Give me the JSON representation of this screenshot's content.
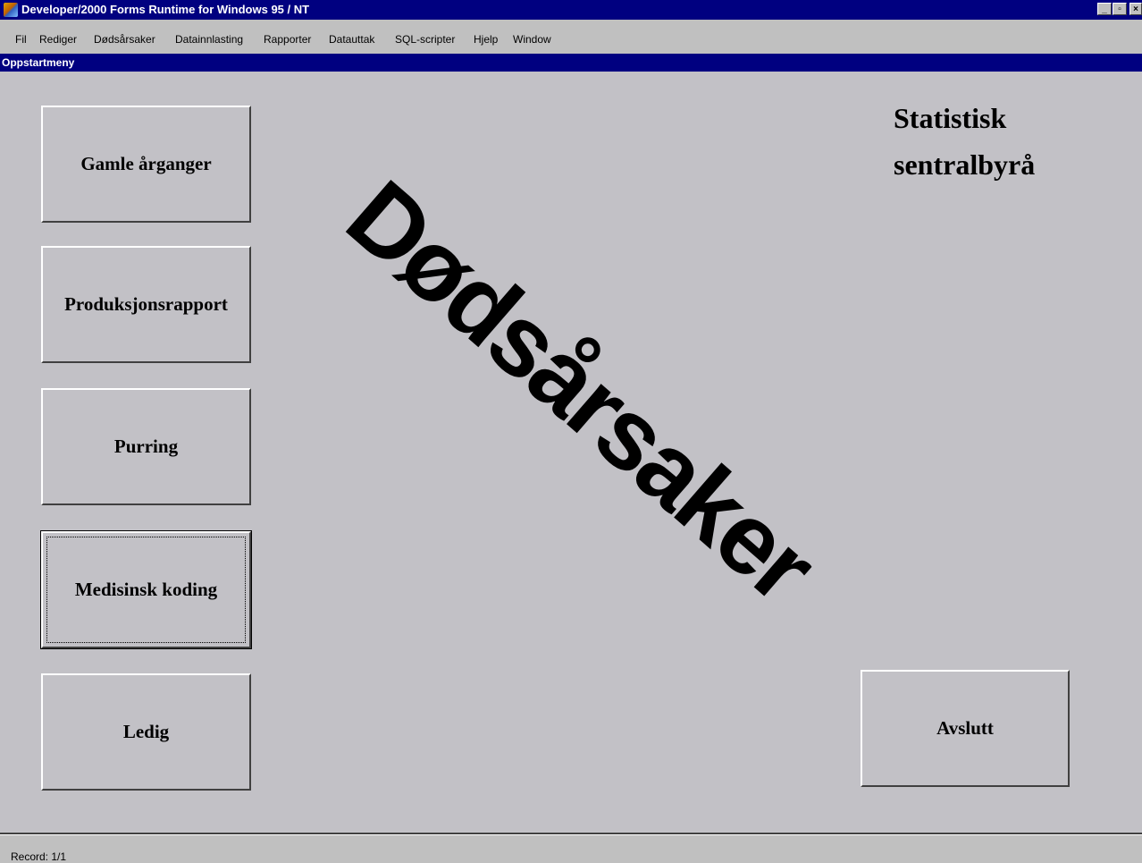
{
  "app": {
    "title": "Developer/2000 Forms Runtime for Windows 95 / NT",
    "minimize_glyph": "_",
    "maximize_glyph": "▫",
    "close_glyph": "×"
  },
  "menu": {
    "items": [
      {
        "label": "Fil"
      },
      {
        "label": "Rediger"
      },
      {
        "label": "Dødsårsaker"
      },
      {
        "label": "Datainnlasting"
      },
      {
        "label": "Rapporter"
      },
      {
        "label": "Datauttak"
      },
      {
        "label": "SQL-scripter"
      },
      {
        "label": "Hjelp"
      },
      {
        "label": "Window"
      }
    ]
  },
  "window": {
    "title": "Oppstartmeny"
  },
  "form": {
    "buttons": [
      {
        "label": "Gamle årganger"
      },
      {
        "label": "Produksjonsrapport"
      },
      {
        "label": "Purring"
      },
      {
        "label": "Medisinsk koding"
      },
      {
        "label": "Ledig"
      }
    ],
    "focused_button": "Medisinsk koding",
    "org_name": "Statistisk sentralbyrå",
    "big_title": "Dødsårsaker",
    "exit_label": "Avslutt"
  },
  "status": {
    "record": "Record: 1/1"
  },
  "colors": {
    "titlebar": "#000080",
    "canvas": "#c2c1c6"
  }
}
